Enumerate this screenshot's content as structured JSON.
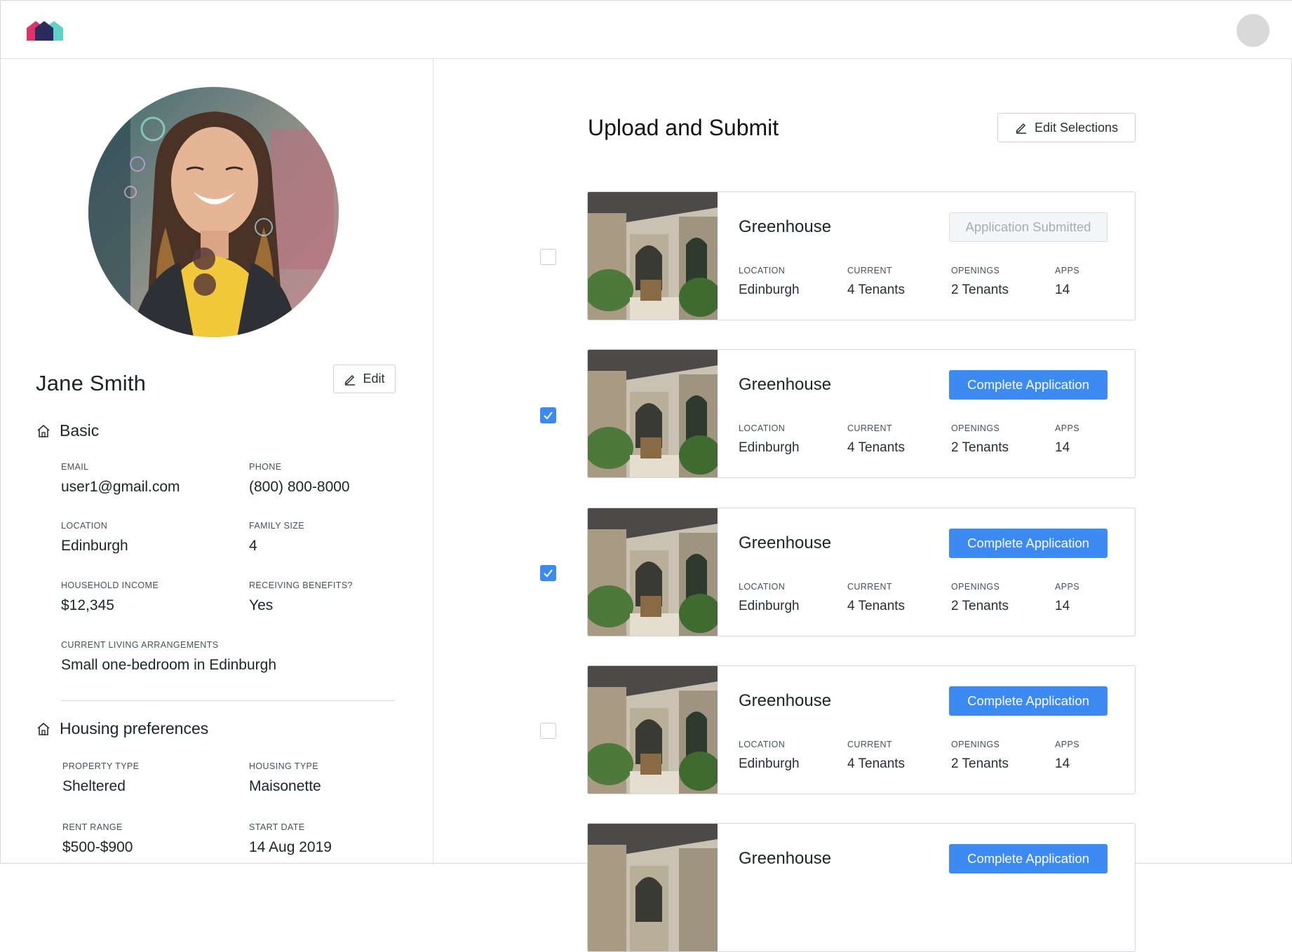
{
  "header": {
    "logo_icon": "house-logo-icon",
    "avatar_icon": "user-avatar-icon"
  },
  "profile": {
    "name": "Jane Smith",
    "edit_label": "Edit",
    "basic": {
      "heading": "Basic",
      "email_label": "EMAIL",
      "email": "user1@gmail.com",
      "phone_label": "PHONE",
      "phone": "(800) 800-8000",
      "location_label": "LOCATION",
      "location": "Edinburgh",
      "family_size_label": "FAMILY SIZE",
      "family_size": "4",
      "income_label": "HOUSEHOLD INCOME",
      "income": "$12,345",
      "benefits_label": "RECEIVING BENEFITS?",
      "benefits": "Yes",
      "living_label": "CURRENT LIVING ARRANGEMENTS",
      "living": "Small one-bedroom in Edinburgh"
    },
    "housing": {
      "heading": "Housing preferences",
      "property_type_label": "PROPERTY TYPE",
      "property_type": "Sheltered",
      "housing_type_label": "HOUSING TYPE",
      "housing_type": "Maisonette",
      "rent_range_label": "RENT RANGE",
      "rent_range": "$500-$900",
      "start_date_label": "START DATE",
      "start_date": "14 Aug 2019"
    }
  },
  "main": {
    "title": "Upload and Submit",
    "edit_selections_label": "Edit Selections",
    "labels": {
      "location": "LOCATION",
      "current": "CURRENT",
      "openings": "OPENINGS",
      "apps": "APPS"
    },
    "cards": [
      {
        "name": "Greenhouse",
        "action": "Application Submitted",
        "location": "Edinburgh",
        "current": "4 Tenants",
        "openings": "2 Tenants",
        "apps": "14",
        "checked": false
      },
      {
        "name": "Greenhouse",
        "action": "Complete Application",
        "location": "Edinburgh",
        "current": "4 Tenants",
        "openings": "2 Tenants",
        "apps": "14",
        "checked": true
      },
      {
        "name": "Greenhouse",
        "action": "Complete Application",
        "location": "Edinburgh",
        "current": "4 Tenants",
        "openings": "2 Tenants",
        "apps": "14",
        "checked": true
      },
      {
        "name": "Greenhouse",
        "action": "Complete Application",
        "location": "Edinburgh",
        "current": "4 Tenants",
        "openings": "2 Tenants",
        "apps": "14",
        "checked": false
      },
      {
        "name": "Greenhouse",
        "action": "Complete Application",
        "checked": false
      }
    ]
  },
  "colors": {
    "accent": "#3d8bf2",
    "border": "#d3d6da"
  }
}
